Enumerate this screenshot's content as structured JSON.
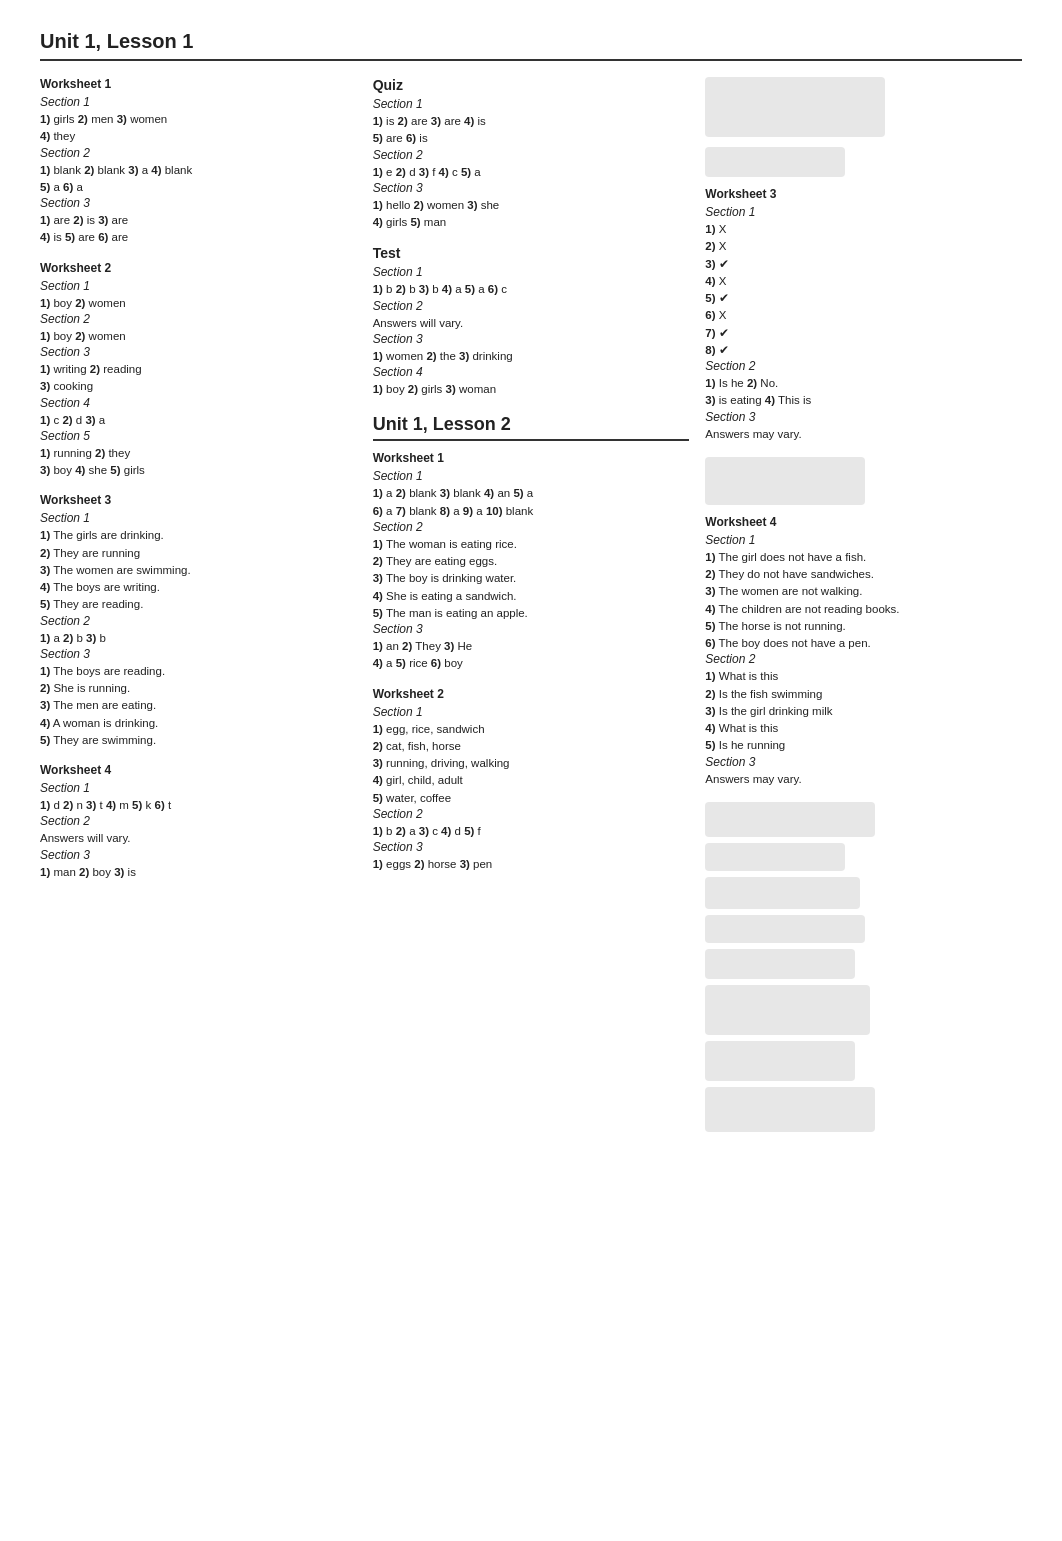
{
  "page": {
    "title": "Unit 1, Lesson 1"
  },
  "unit2_title": "Unit 1, Lesson 2",
  "col1": {
    "sections": [
      {
        "title": "Worksheet 1",
        "items": [
          {
            "label": "Section 1",
            "lines": [
              "1) girls 2) men 3) women",
              "4) they"
            ]
          },
          {
            "label": "Section 2",
            "lines": [
              "1) blank 2) blank 3) a 4) blank",
              "5) a 6) a"
            ]
          },
          {
            "label": "Section 3",
            "lines": [
              "1) are 2) is 3) are",
              "4) is 5) are 6) are"
            ]
          }
        ]
      },
      {
        "title": "Worksheet 2",
        "items": [
          {
            "label": "Section 1",
            "lines": [
              "1) boy 2) women"
            ]
          },
          {
            "label": "Section 2",
            "lines": [
              "1) boy 2) women"
            ]
          },
          {
            "label": "Section 3",
            "lines": [
              "1) writing 2) reading",
              "3) cooking"
            ]
          },
          {
            "label": "Section 4",
            "lines": [
              "1) c 2) d 3) a"
            ]
          },
          {
            "label": "Section 5",
            "lines": [
              "1) running 2) they",
              "3) boy 4) she 5) girls"
            ]
          }
        ]
      },
      {
        "title": "Worksheet 3",
        "items": [
          {
            "label": "Section 1",
            "lines": [
              "1) The girls are drinking.",
              "2) They are running",
              "3) The women are swimming.",
              "4) The boys are writing.",
              "5) They are reading."
            ]
          },
          {
            "label": "Section 2",
            "lines": [
              "1) a 2) b 3) b"
            ]
          },
          {
            "label": "Section 3",
            "lines": [
              "1) The boys are reading.",
              "2) She is running.",
              "3) The men are eating.",
              "4) A woman is drinking.",
              "5) They are swimming."
            ]
          }
        ]
      },
      {
        "title": "Worksheet 4",
        "items": [
          {
            "label": "Section 1",
            "lines": [
              "1) d 2) n 3) t 4) m 5) k 6) t"
            ]
          },
          {
            "label": "Section 2",
            "lines": [
              "Answers will vary."
            ]
          },
          {
            "label": "Section 3",
            "lines": [
              "1) man 2) boy 3) is"
            ]
          }
        ]
      }
    ]
  },
  "col2": {
    "quiz": {
      "title": "Quiz",
      "items": [
        {
          "label": "Section 1",
          "lines": [
            "1) is 2) are 3) are 4) is",
            "5) are 6) is"
          ]
        },
        {
          "label": "Section 2",
          "lines": [
            "1) e 2) d 3) f 4) c 5) a"
          ]
        },
        {
          "label": "Section 3",
          "lines": [
            "1) hello 2) women 3) she",
            "4) girls 5) man"
          ]
        }
      ]
    },
    "test": {
      "title": "Test",
      "items": [
        {
          "label": "Section 1",
          "lines": [
            "1) b 2) b 3) b 4) a 5) a 6) c"
          ]
        },
        {
          "label": "Section 2",
          "lines": [
            "Answers will vary."
          ]
        },
        {
          "label": "Section 3",
          "lines": [
            "1) women 2) the 3) drinking"
          ]
        },
        {
          "label": "Section 4",
          "lines": [
            "1) boy 2) girls 3) woman"
          ]
        }
      ]
    },
    "worksheet1_u2": {
      "title": "Worksheet 1",
      "items": [
        {
          "label": "Section 1",
          "lines": [
            "1) a 2) blank 3) blank 4) an 5) a",
            "6) a 7) blank 8) a 9) a 10) blank"
          ]
        },
        {
          "label": "Section 2",
          "lines": [
            "1) The woman is eating rice.",
            "2) They are eating eggs.",
            "3) The boy is drinking water.",
            "4) She is eating a sandwich.",
            "5) The man is eating an apple."
          ]
        },
        {
          "label": "Section 3",
          "lines": [
            "1) an 2) They 3) He",
            "4) a 5) rice 6) boy"
          ]
        }
      ]
    },
    "worksheet2_u2": {
      "title": "Worksheet 2",
      "items": [
        {
          "label": "Section 1",
          "lines": [
            "1) egg, rice, sandwich",
            "2) cat, fish, horse",
            "3) running, driving, walking",
            "4) girl, child, adult",
            "5) water, coffee"
          ]
        },
        {
          "label": "Section 2",
          "lines": [
            "1) b 2) a 3) c 4) d 5) f"
          ]
        },
        {
          "label": "Section 3",
          "lines": [
            "1) eggs 2) horse 3) pen"
          ]
        }
      ]
    }
  },
  "col3": {
    "worksheet3": {
      "title": "Worksheet 3",
      "items": [
        {
          "label": "Section 1",
          "lines": [
            "1) X",
            "2) X",
            "3) ✔",
            "4) X",
            "5) ✔",
            "6) X",
            "7) ✔",
            "8) ✔"
          ]
        },
        {
          "label": "Section 2",
          "lines": [
            "1) Is he 2) No.",
            "3) is eating 4) This is"
          ]
        },
        {
          "label": "Section 3",
          "lines": [
            "Answers may vary."
          ]
        }
      ]
    },
    "worksheet4": {
      "title": "Worksheet 4",
      "items": [
        {
          "label": "Section 1",
          "lines": [
            "1) The girl does not have a fish.",
            "2) They do not have sandwiches.",
            "3) The women are not walking.",
            "4) The children are not reading books.",
            "5) The horse is not running.",
            "6) The boy does not have a pen."
          ]
        },
        {
          "label": "Section 2",
          "lines": [
            "1) What is this",
            "2) Is the fish swimming",
            "3) Is the girl drinking milk",
            "4) What is this",
            "5) Is he running"
          ]
        },
        {
          "label": "Section 3",
          "lines": [
            "Answers may vary."
          ]
        }
      ]
    }
  }
}
